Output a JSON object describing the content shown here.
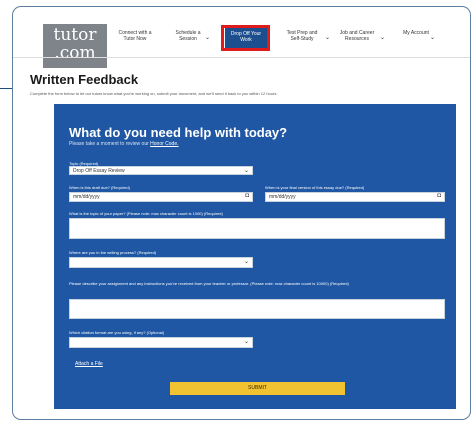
{
  "logo": {
    "top": "tutor",
    "bottom": ".com"
  },
  "nav": {
    "items": [
      {
        "label": "Connect with a Tutor Now"
      },
      {
        "label": "Schedule a Session"
      },
      {
        "label": "Drop Off Your Work"
      },
      {
        "label": "Test Prep and Self-Study"
      },
      {
        "label": "Job and Career Resources"
      },
      {
        "label": "My Account"
      }
    ],
    "chevron": "⌄"
  },
  "page": {
    "title": "Written Feedback",
    "description": "Complete the form below to let our tutors know what you're working on, submit your document, and we'll send it back to you within 12 hours."
  },
  "form": {
    "heading": "What do you need help with today?",
    "subheading": "Please take a moment to review our",
    "subheading_link": "Honor Code.",
    "topic_label": "Topic (Required)",
    "topic_value": "Drop Off Essay Review",
    "draft_due_label": "When is this draft due? (Required)",
    "draft_due_value": "mm/dd/yyyy",
    "final_due_label": "When is your final version of this essay due? (Required)",
    "final_due_value": "mm/dd/yyyy",
    "topic_paper_label": "What is the topic of your paper? (Please note: max character count is 1000) (Required)",
    "process_label": "Where are you in the writing process? (Required)",
    "assignment_label": "Please describe your assignment and any instructions you've received from your teacher or professor. (Please note: max character count is 10000) (Required)",
    "citation_label": "Which citation format are you using, if any? (Optional)",
    "attach_label": "Attach a File",
    "submit_label": "SUBMIT",
    "calendar_icon": "calendar-icon",
    "dropdown_icon": "chevron-down-icon"
  },
  "colors": {
    "panel": "#1f57a4",
    "active_tab": "#1d4f8f",
    "highlight": "#e11b1b",
    "submit": "#f1c232",
    "logo": "#7f848a"
  }
}
